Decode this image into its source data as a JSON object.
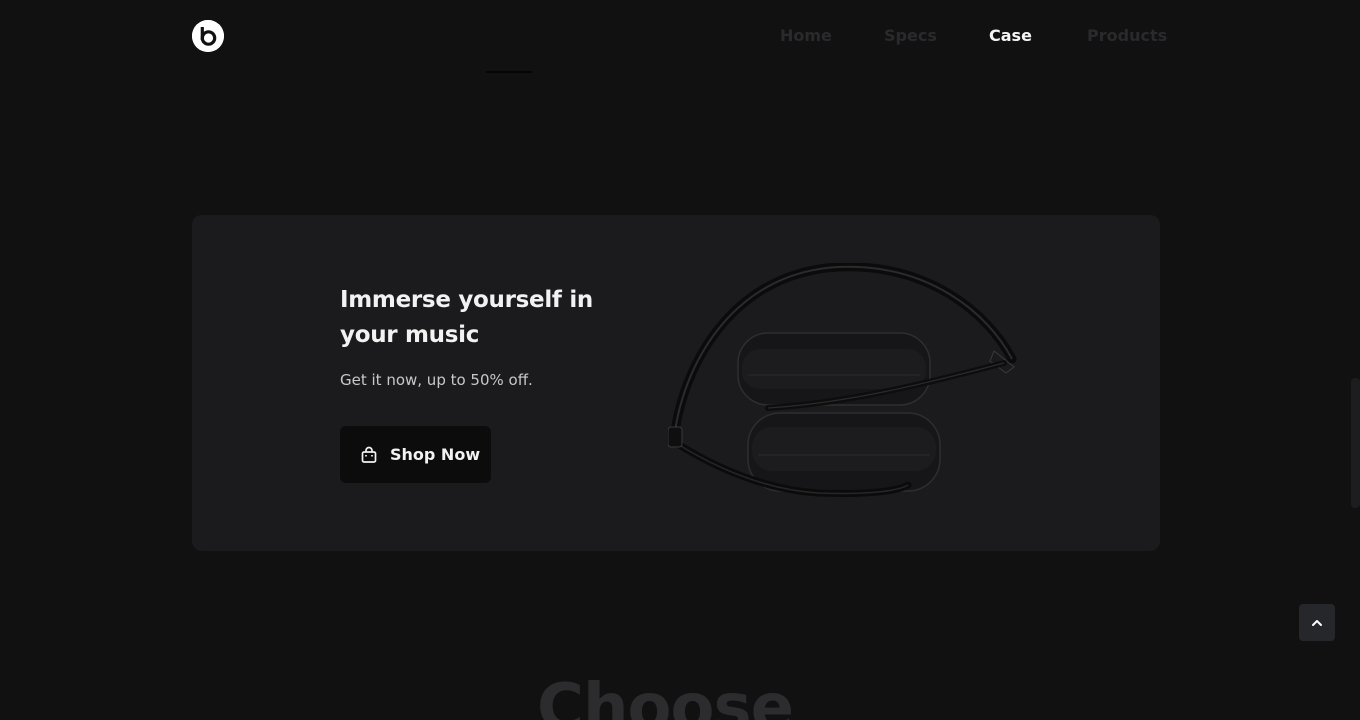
{
  "header": {
    "logo_icon": "beats-logo-icon",
    "nav": [
      {
        "label": "Home",
        "active": false
      },
      {
        "label": "Specs",
        "active": false
      },
      {
        "label": "Case",
        "active": true
      },
      {
        "label": "Products",
        "active": false
      }
    ]
  },
  "promo": {
    "headline": "Immerse yourself in your music",
    "subtext": "Get it now, up to 50% off.",
    "button_label": "Shop Now",
    "button_icon": "shopping-bag-icon",
    "image": "folded-headphones-image"
  },
  "section": {
    "heading": "Choose"
  },
  "controls": {
    "back_to_top_icon": "chevron-up-icon"
  },
  "colors": {
    "background": "#111112",
    "card": "#1b1b1d",
    "button": "#0c0c0d",
    "nav_active": "#f4f4f4",
    "nav_inactive": "#2a2a2c"
  }
}
